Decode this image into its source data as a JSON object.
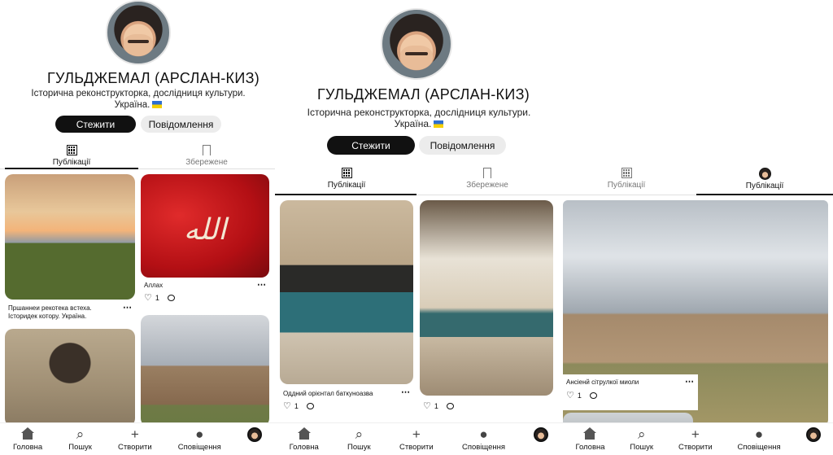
{
  "profile": {
    "name": "ГУЛЬДЖЕМАЛ (АРСЛАН-КИЗ)",
    "bio_line1": "Історична реконструкторка, дослідниця культури.",
    "bio_line2": "Україна.",
    "follow_label": "Стежити",
    "message_label": "Повідомлення"
  },
  "tabs": {
    "posts": "Публікації",
    "saved": "Збережене"
  },
  "screen1": {
    "posts": [
      {
        "caption": "Пршаннеи рекотека встеха. Історидек котору. Україна.",
        "likes": "",
        "image": "sunset-horse-castle"
      },
      {
        "caption": "Аллах",
        "likes": "1",
        "image": "red-flag-calligraphy",
        "image_text": "الله"
      },
      {
        "caption": "",
        "likes": "",
        "image": "stone-arch"
      },
      {
        "caption": "",
        "likes": "",
        "image": "fortress-ruins"
      }
    ]
  },
  "screen2": {
    "posts": [
      {
        "caption": "Оддний орієнтал баткуноазва",
        "likes": "1",
        "image": "blue-tiled-arch"
      },
      {
        "caption": "",
        "likes": "1",
        "image": "domed-interior-fountain"
      }
    ]
  },
  "screen3": {
    "posts": [
      {
        "caption": "Ансіенй сітрулкої миоли",
        "likes": "1",
        "image": "fortress-wall"
      }
    ]
  },
  "nav": {
    "home": "Головна",
    "search": "Пошук",
    "create": "Створити",
    "notifications": "Сповіщення"
  },
  "icons": {
    "more": "more-dots-icon",
    "like": "heart-icon",
    "comment": "comment-icon"
  },
  "colors": {
    "follow_button": "#111111",
    "message_button": "#ececec",
    "flag_blue": "#2e6fd1",
    "flag_yellow": "#f5d000"
  }
}
